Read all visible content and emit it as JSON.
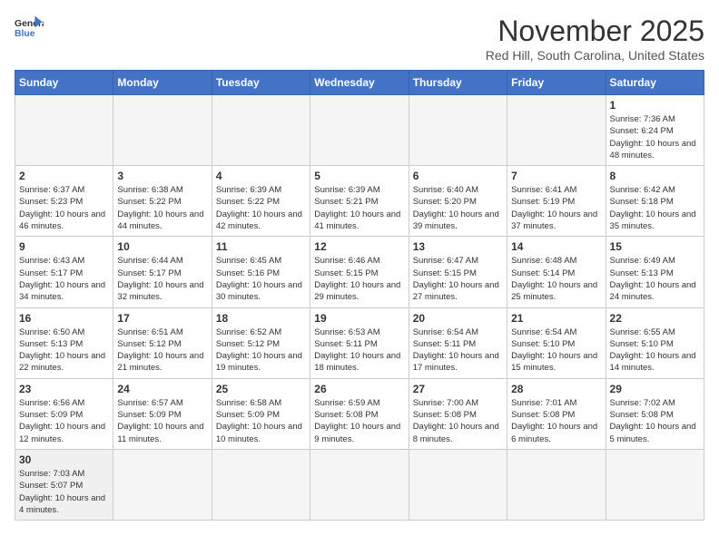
{
  "header": {
    "logo_general": "General",
    "logo_blue": "Blue",
    "month_title": "November 2025",
    "location": "Red Hill, South Carolina, United States"
  },
  "days_of_week": [
    "Sunday",
    "Monday",
    "Tuesday",
    "Wednesday",
    "Thursday",
    "Friday",
    "Saturday"
  ],
  "weeks": [
    [
      {
        "day": "",
        "info": ""
      },
      {
        "day": "",
        "info": ""
      },
      {
        "day": "",
        "info": ""
      },
      {
        "day": "",
        "info": ""
      },
      {
        "day": "",
        "info": ""
      },
      {
        "day": "",
        "info": ""
      },
      {
        "day": "1",
        "info": "Sunrise: 7:36 AM\nSunset: 6:24 PM\nDaylight: 10 hours\nand 48 minutes."
      }
    ],
    [
      {
        "day": "2",
        "info": "Sunrise: 6:37 AM\nSunset: 5:23 PM\nDaylight: 10 hours\nand 46 minutes."
      },
      {
        "day": "3",
        "info": "Sunrise: 6:38 AM\nSunset: 5:22 PM\nDaylight: 10 hours\nand 44 minutes."
      },
      {
        "day": "4",
        "info": "Sunrise: 6:39 AM\nSunset: 5:22 PM\nDaylight: 10 hours\nand 42 minutes."
      },
      {
        "day": "5",
        "info": "Sunrise: 6:39 AM\nSunset: 5:21 PM\nDaylight: 10 hours\nand 41 minutes."
      },
      {
        "day": "6",
        "info": "Sunrise: 6:40 AM\nSunset: 5:20 PM\nDaylight: 10 hours\nand 39 minutes."
      },
      {
        "day": "7",
        "info": "Sunrise: 6:41 AM\nSunset: 5:19 PM\nDaylight: 10 hours\nand 37 minutes."
      },
      {
        "day": "8",
        "info": "Sunrise: 6:42 AM\nSunset: 5:18 PM\nDaylight: 10 hours\nand 35 minutes."
      }
    ],
    [
      {
        "day": "9",
        "info": "Sunrise: 6:43 AM\nSunset: 5:17 PM\nDaylight: 10 hours\nand 34 minutes."
      },
      {
        "day": "10",
        "info": "Sunrise: 6:44 AM\nSunset: 5:17 PM\nDaylight: 10 hours\nand 32 minutes."
      },
      {
        "day": "11",
        "info": "Sunrise: 6:45 AM\nSunset: 5:16 PM\nDaylight: 10 hours\nand 30 minutes."
      },
      {
        "day": "12",
        "info": "Sunrise: 6:46 AM\nSunset: 5:15 PM\nDaylight: 10 hours\nand 29 minutes."
      },
      {
        "day": "13",
        "info": "Sunrise: 6:47 AM\nSunset: 5:15 PM\nDaylight: 10 hours\nand 27 minutes."
      },
      {
        "day": "14",
        "info": "Sunrise: 6:48 AM\nSunset: 5:14 PM\nDaylight: 10 hours\nand 25 minutes."
      },
      {
        "day": "15",
        "info": "Sunrise: 6:49 AM\nSunset: 5:13 PM\nDaylight: 10 hours\nand 24 minutes."
      }
    ],
    [
      {
        "day": "16",
        "info": "Sunrise: 6:50 AM\nSunset: 5:13 PM\nDaylight: 10 hours\nand 22 minutes."
      },
      {
        "day": "17",
        "info": "Sunrise: 6:51 AM\nSunset: 5:12 PM\nDaylight: 10 hours\nand 21 minutes."
      },
      {
        "day": "18",
        "info": "Sunrise: 6:52 AM\nSunset: 5:12 PM\nDaylight: 10 hours\nand 19 minutes."
      },
      {
        "day": "19",
        "info": "Sunrise: 6:53 AM\nSunset: 5:11 PM\nDaylight: 10 hours\nand 18 minutes."
      },
      {
        "day": "20",
        "info": "Sunrise: 6:54 AM\nSunset: 5:11 PM\nDaylight: 10 hours\nand 17 minutes."
      },
      {
        "day": "21",
        "info": "Sunrise: 6:54 AM\nSunset: 5:10 PM\nDaylight: 10 hours\nand 15 minutes."
      },
      {
        "day": "22",
        "info": "Sunrise: 6:55 AM\nSunset: 5:10 PM\nDaylight: 10 hours\nand 14 minutes."
      }
    ],
    [
      {
        "day": "23",
        "info": "Sunrise: 6:56 AM\nSunset: 5:09 PM\nDaylight: 10 hours\nand 12 minutes."
      },
      {
        "day": "24",
        "info": "Sunrise: 6:57 AM\nSunset: 5:09 PM\nDaylight: 10 hours\nand 11 minutes."
      },
      {
        "day": "25",
        "info": "Sunrise: 6:58 AM\nSunset: 5:09 PM\nDaylight: 10 hours\nand 10 minutes."
      },
      {
        "day": "26",
        "info": "Sunrise: 6:59 AM\nSunset: 5:08 PM\nDaylight: 10 hours\nand 9 minutes."
      },
      {
        "day": "27",
        "info": "Sunrise: 7:00 AM\nSunset: 5:08 PM\nDaylight: 10 hours\nand 8 minutes."
      },
      {
        "day": "28",
        "info": "Sunrise: 7:01 AM\nSunset: 5:08 PM\nDaylight: 10 hours\nand 6 minutes."
      },
      {
        "day": "29",
        "info": "Sunrise: 7:02 AM\nSunset: 5:08 PM\nDaylight: 10 hours\nand 5 minutes."
      }
    ],
    [
      {
        "day": "30",
        "info": "Sunrise: 7:03 AM\nSunset: 5:07 PM\nDaylight: 10 hours\nand 4 minutes."
      },
      {
        "day": "",
        "info": ""
      },
      {
        "day": "",
        "info": ""
      },
      {
        "day": "",
        "info": ""
      },
      {
        "day": "",
        "info": ""
      },
      {
        "day": "",
        "info": ""
      },
      {
        "day": "",
        "info": ""
      }
    ]
  ]
}
